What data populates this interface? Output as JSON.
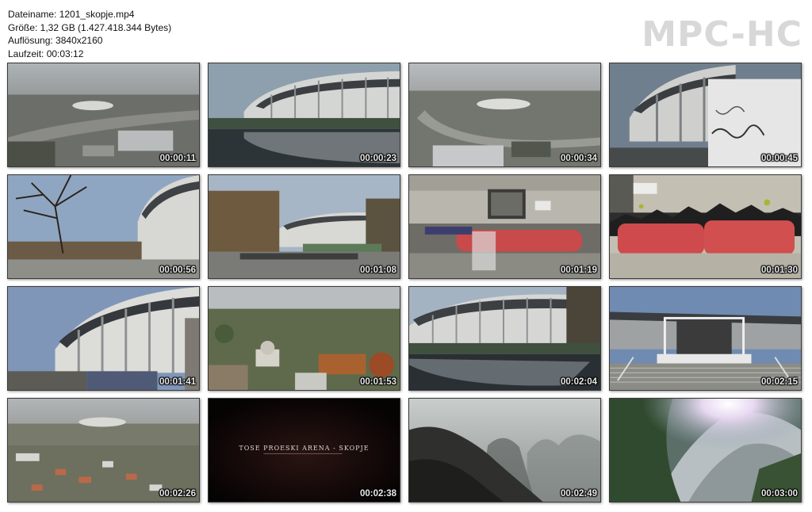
{
  "info": {
    "filename": "Dateiname: 1201_skopje.mp4",
    "size": "Größe: 1,32 GB (1.427.418.344 Bytes)",
    "resolution": "Auflösung: 3840x2160",
    "duration": "Laufzeit: 00:03:12"
  },
  "logo": "MPC-HC",
  "thumbnails": [
    {
      "timestamp": "00:00:11",
      "scene": "aerial-city-stadium"
    },
    {
      "timestamp": "00:00:23",
      "scene": "stadium-reflection"
    },
    {
      "timestamp": "00:00:34",
      "scene": "aerial-city-stadium"
    },
    {
      "timestamp": "00:00:45",
      "scene": "stadium-graffiti-wall"
    },
    {
      "timestamp": "00:00:56",
      "scene": "tree-and-stadium"
    },
    {
      "timestamp": "00:01:08",
      "scene": "park-and-stadium"
    },
    {
      "timestamp": "00:01:19",
      "scene": "building-graffiti"
    },
    {
      "timestamp": "00:01:30",
      "scene": "graffiti-closeup"
    },
    {
      "timestamp": "00:01:41",
      "scene": "stadium-low-angle"
    },
    {
      "timestamp": "00:01:53",
      "scene": "aerial-mosque"
    },
    {
      "timestamp": "00:02:04",
      "scene": "stadium-reflection"
    },
    {
      "timestamp": "00:02:15",
      "scene": "stadium-entrance"
    },
    {
      "timestamp": "00:02:26",
      "scene": "aerial-residential"
    },
    {
      "timestamp": "00:02:38",
      "scene": "title-card",
      "caption": "TOSE PROESKI ARENA - SKOPJE"
    },
    {
      "timestamp": "00:02:49",
      "scene": "misty-rocks"
    },
    {
      "timestamp": "00:03:00",
      "scene": "sunlit-mountain"
    }
  ]
}
